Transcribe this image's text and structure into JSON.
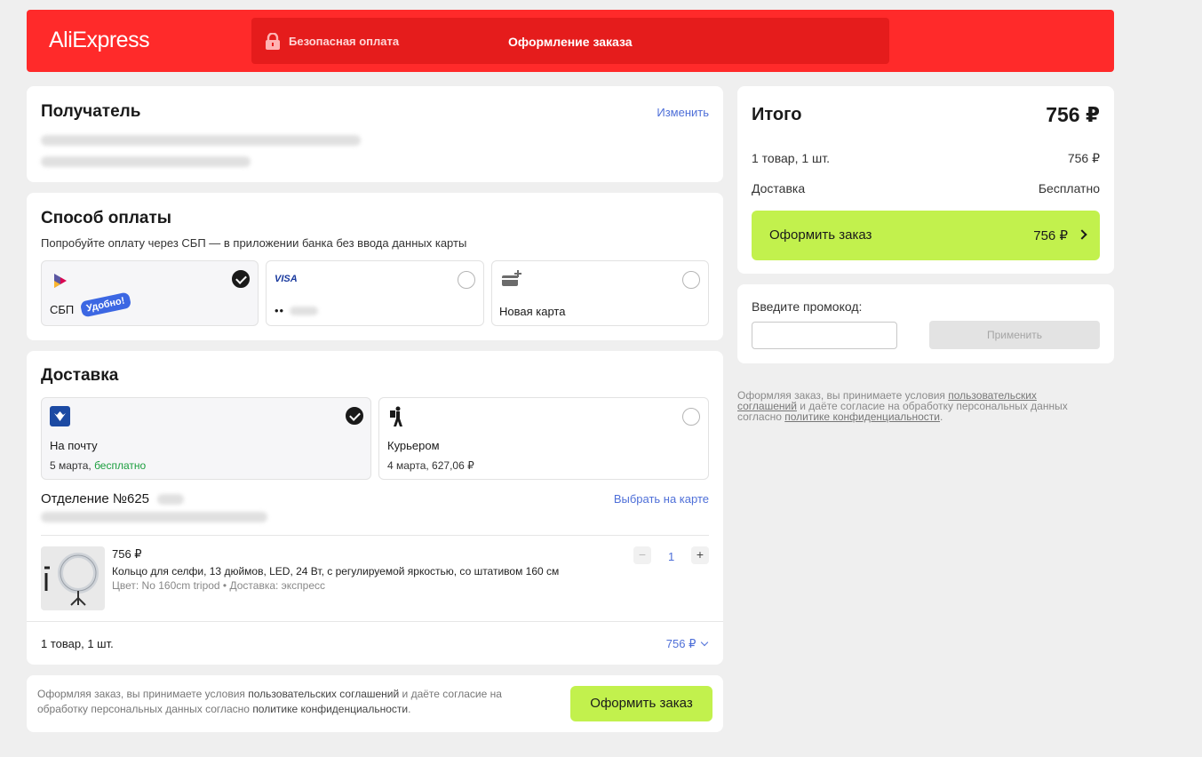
{
  "header": {
    "logo": "AliExpress",
    "secure_label": "Безопасная оплата",
    "title": "Оформление заказа",
    "brand_color": "#ff2a2a"
  },
  "recipient": {
    "title": "Получатель",
    "edit_label": "Изменить"
  },
  "payment": {
    "title": "Способ оплаты",
    "hint": "Попробуйте оплату через СБП — в приложении банка без ввода данных карты",
    "options": [
      {
        "label": "СБП",
        "badge": "Удобно!",
        "icon": "sbp-icon",
        "selected": true
      },
      {
        "brand": "VISA",
        "mask": "••",
        "icon": "visa-icon",
        "selected": false
      },
      {
        "label": "Новая карта",
        "icon": "add-card-icon",
        "selected": false
      }
    ]
  },
  "delivery": {
    "title": "Доставка",
    "options": [
      {
        "label": "На почту",
        "date": "5 марта,",
        "price": "бесплатно",
        "icon": "russian-post-icon",
        "selected": true
      },
      {
        "label": "Курьером",
        "date": "4 марта, 627,06 ₽",
        "icon": "courier-icon",
        "selected": false
      }
    ],
    "office_title": "Отделение №625",
    "map_link": "Выбрать на карте",
    "item": {
      "price": "756 ₽",
      "name": "Кольцо для селфи, 13 дюймов, LED, 24 Вт, с регулируемой яркостью, со штативом 160 см",
      "details": "Цвет: No 160cm tripod • Доставка: экспресс",
      "quantity": "1",
      "minus": "−",
      "plus": "+"
    },
    "summary_label": "1 товар, 1 шт.",
    "summary_price": "756 ₽"
  },
  "bottom": {
    "legal_prefix": "Оформляя заказ, вы принимаете условия ",
    "legal_link1": "пользовательских соглашений",
    "legal_middle": " и даёте согласие на обработку персональных данных согласно ",
    "legal_link2": "политике конфиденциальности",
    "legal_suffix": ".",
    "button": "Оформить заказ"
  },
  "total": {
    "title": "Итого",
    "amount": "756 ₽",
    "items_label": "1 товар, 1 шт.",
    "items_price": "756 ₽",
    "delivery_label": "Доставка",
    "delivery_value": "Бесплатно",
    "button_label": "Оформить заказ",
    "button_price": "756 ₽",
    "accent_color": "#c2f14d"
  },
  "promo": {
    "label": "Введите промокод:",
    "placeholder": "",
    "apply": "Применить"
  },
  "legal_right": {
    "prefix": "Оформляя заказ, вы принимаете условия ",
    "link1": "пользовательских соглашений",
    "middle": " и даёте согласие на обработку персональных данных согласно ",
    "link2": "политике конфиденциальности",
    "suffix": "."
  }
}
